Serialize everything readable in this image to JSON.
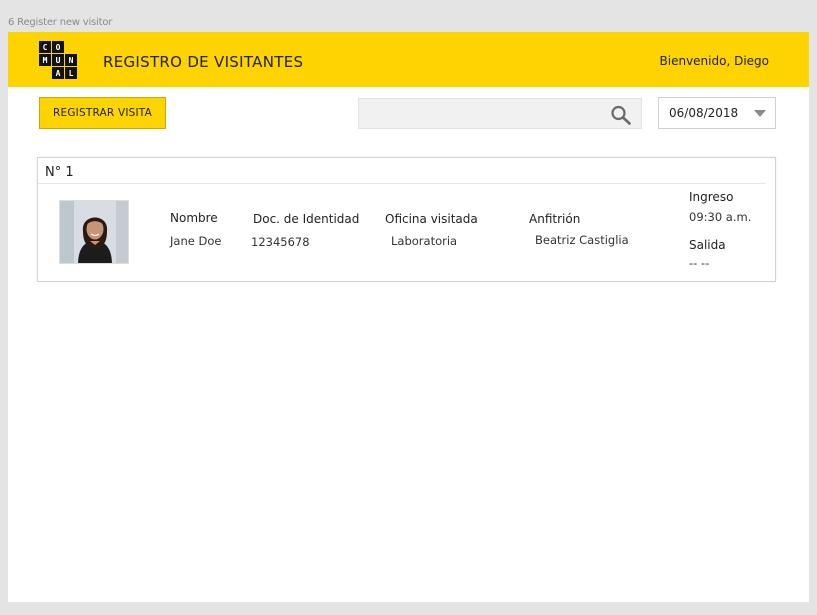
{
  "frame_label": "6 Register new visitor",
  "header": {
    "logo_letters": [
      "C",
      "O",
      "",
      "M",
      "U",
      "N",
      "",
      "A",
      "L"
    ],
    "title": "REGISTRO DE VISITANTES",
    "welcome": "Bienvenido, Diego",
    "color": "#fdd300"
  },
  "toolbar": {
    "register_label": "REGISTRAR VISITA",
    "search_value": "",
    "search_placeholder": "",
    "date_value": "06/08/2018"
  },
  "visitors": [
    {
      "number": "N° 1",
      "avatar_icon": "person-photo",
      "name_label": "Nombre",
      "name": "Jane Doe",
      "doc_label": "Doc. de Identidad",
      "doc": "12345678",
      "office_label": "Oficina visitada",
      "office": "Laboratoria",
      "host_label": "Anfitrión",
      "host": "Beatriz Castiglia",
      "entry_label": "Ingreso",
      "entry": "09:30 a.m.",
      "exit_label": "Salida",
      "exit": "-- --"
    }
  ]
}
